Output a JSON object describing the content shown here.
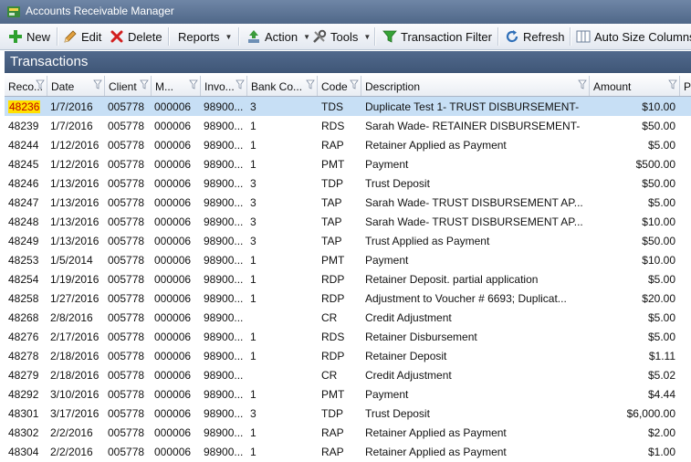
{
  "window": {
    "title": "Accounts Receivable Manager"
  },
  "toolbar": {
    "new": "New",
    "edit": "Edit",
    "delete": "Delete",
    "reports": "Reports",
    "action": "Action",
    "tools": "Tools",
    "transaction_filter": "Transaction Filter",
    "refresh": "Refresh",
    "auto_size": "Auto Size Columns"
  },
  "section": {
    "title": "Transactions"
  },
  "columns": [
    "Reco...",
    "Date",
    "Client",
    "M...",
    "Invo...",
    "Bank Co...",
    "Code",
    "Description",
    "Amount",
    "P"
  ],
  "rows": [
    [
      "48236",
      "1/7/2016",
      "005778",
      "000006",
      "98900...",
      "3",
      "TDS",
      "Duplicate Test 1- TRUST DISBURSEMENT-",
      "$10.00"
    ],
    [
      "48239",
      "1/7/2016",
      "005778",
      "000006",
      "98900...",
      "1",
      "RDS",
      "Sarah Wade- RETAINER DISBURSEMENT-",
      "$50.00"
    ],
    [
      "48244",
      "1/12/2016",
      "005778",
      "000006",
      "98900...",
      "1",
      "RAP",
      "Retainer Applied as Payment",
      "$5.00"
    ],
    [
      "48245",
      "1/12/2016",
      "005778",
      "000006",
      "98900...",
      "1",
      "PMT",
      "Payment",
      "$500.00"
    ],
    [
      "48246",
      "1/13/2016",
      "005778",
      "000006",
      "98900...",
      "3",
      "TDP",
      "Trust Deposit",
      "$50.00"
    ],
    [
      "48247",
      "1/13/2016",
      "005778",
      "000006",
      "98900...",
      "3",
      "TAP",
      "Sarah Wade- TRUST DISBURSEMENT AP...",
      "$5.00"
    ],
    [
      "48248",
      "1/13/2016",
      "005778",
      "000006",
      "98900...",
      "3",
      "TAP",
      "Sarah Wade- TRUST DISBURSEMENT AP...",
      "$10.00"
    ],
    [
      "48249",
      "1/13/2016",
      "005778",
      "000006",
      "98900...",
      "3",
      "TAP",
      "Trust Applied as Payment",
      "$50.00"
    ],
    [
      "48253",
      "1/5/2014",
      "005778",
      "000006",
      "98900...",
      "1",
      "PMT",
      "Payment",
      "$10.00"
    ],
    [
      "48254",
      "1/19/2016",
      "005778",
      "000006",
      "98900...",
      "1",
      "RDP",
      "Retainer Deposit. partial application",
      "$5.00"
    ],
    [
      "48258",
      "1/27/2016",
      "005778",
      "000006",
      "98900...",
      "1",
      "RDP",
      "Adjustment to Voucher # 6693; Duplicat...",
      "$20.00"
    ],
    [
      "48268",
      "2/8/2016",
      "005778",
      "000006",
      "98900...",
      "",
      "CR",
      "Credit Adjustment",
      "$5.00"
    ],
    [
      "48276",
      "2/17/2016",
      "005778",
      "000006",
      "98900...",
      "1",
      "RDS",
      "Retainer Disbursement",
      "$5.00"
    ],
    [
      "48278",
      "2/18/2016",
      "005778",
      "000006",
      "98900...",
      "1",
      "RDP",
      "Retainer Deposit",
      "$1.11"
    ],
    [
      "48279",
      "2/18/2016",
      "005778",
      "000006",
      "98900...",
      "",
      "CR",
      "Credit Adjustment",
      "$5.02"
    ],
    [
      "48292",
      "3/10/2016",
      "005778",
      "000006",
      "98900...",
      "1",
      "PMT",
      "Payment",
      "$4.44"
    ],
    [
      "48301",
      "3/17/2016",
      "005778",
      "000006",
      "98900...",
      "3",
      "TDP",
      "Trust Deposit",
      "$6,000.00"
    ],
    [
      "48302",
      "2/2/2016",
      "005778",
      "000006",
      "98900...",
      "1",
      "RAP",
      "Retainer Applied as Payment",
      "$2.00"
    ],
    [
      "48304",
      "2/2/2016",
      "005778",
      "000006",
      "98900...",
      "1",
      "RAP",
      "Retainer Applied as Payment",
      "$1.00"
    ]
  ],
  "selected_row_index": 0,
  "colors": {
    "title_bar": "#5a7395",
    "section_bar": "#48607f",
    "selected_row": "#c7dff5",
    "selected_cell": "#ffe000"
  }
}
